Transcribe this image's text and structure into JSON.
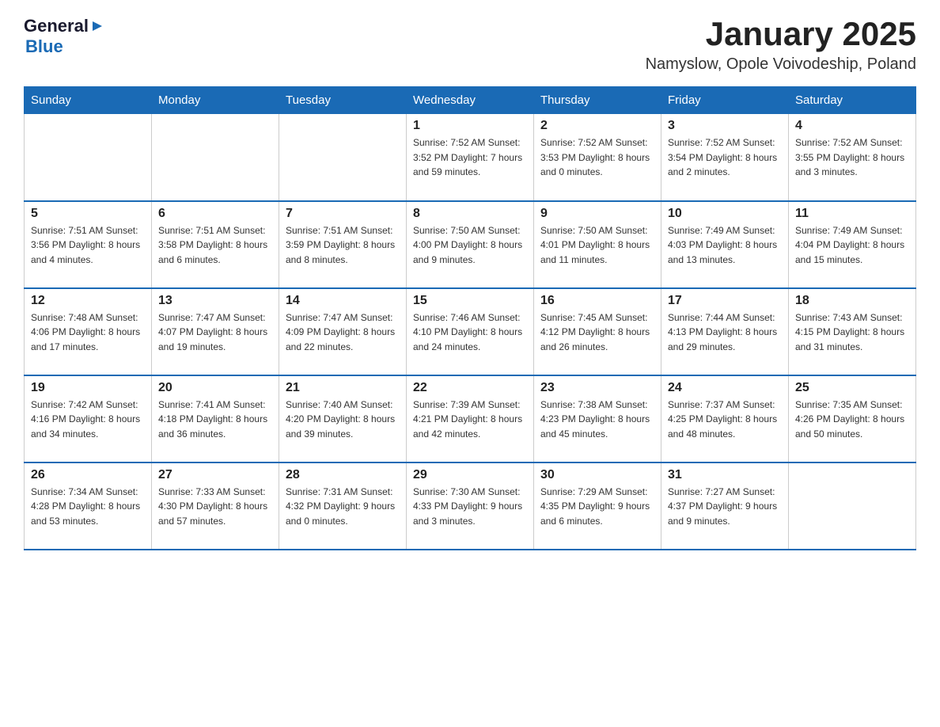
{
  "header": {
    "logo_general": "General",
    "logo_blue": "Blue",
    "month_title": "January 2025",
    "location": "Namyslow, Opole Voivodeship, Poland"
  },
  "weekdays": [
    "Sunday",
    "Monday",
    "Tuesday",
    "Wednesday",
    "Thursday",
    "Friday",
    "Saturday"
  ],
  "weeks": [
    [
      {
        "day": "",
        "info": ""
      },
      {
        "day": "",
        "info": ""
      },
      {
        "day": "",
        "info": ""
      },
      {
        "day": "1",
        "info": "Sunrise: 7:52 AM\nSunset: 3:52 PM\nDaylight: 7 hours\nand 59 minutes."
      },
      {
        "day": "2",
        "info": "Sunrise: 7:52 AM\nSunset: 3:53 PM\nDaylight: 8 hours\nand 0 minutes."
      },
      {
        "day": "3",
        "info": "Sunrise: 7:52 AM\nSunset: 3:54 PM\nDaylight: 8 hours\nand 2 minutes."
      },
      {
        "day": "4",
        "info": "Sunrise: 7:52 AM\nSunset: 3:55 PM\nDaylight: 8 hours\nand 3 minutes."
      }
    ],
    [
      {
        "day": "5",
        "info": "Sunrise: 7:51 AM\nSunset: 3:56 PM\nDaylight: 8 hours\nand 4 minutes."
      },
      {
        "day": "6",
        "info": "Sunrise: 7:51 AM\nSunset: 3:58 PM\nDaylight: 8 hours\nand 6 minutes."
      },
      {
        "day": "7",
        "info": "Sunrise: 7:51 AM\nSunset: 3:59 PM\nDaylight: 8 hours\nand 8 minutes."
      },
      {
        "day": "8",
        "info": "Sunrise: 7:50 AM\nSunset: 4:00 PM\nDaylight: 8 hours\nand 9 minutes."
      },
      {
        "day": "9",
        "info": "Sunrise: 7:50 AM\nSunset: 4:01 PM\nDaylight: 8 hours\nand 11 minutes."
      },
      {
        "day": "10",
        "info": "Sunrise: 7:49 AM\nSunset: 4:03 PM\nDaylight: 8 hours\nand 13 minutes."
      },
      {
        "day": "11",
        "info": "Sunrise: 7:49 AM\nSunset: 4:04 PM\nDaylight: 8 hours\nand 15 minutes."
      }
    ],
    [
      {
        "day": "12",
        "info": "Sunrise: 7:48 AM\nSunset: 4:06 PM\nDaylight: 8 hours\nand 17 minutes."
      },
      {
        "day": "13",
        "info": "Sunrise: 7:47 AM\nSunset: 4:07 PM\nDaylight: 8 hours\nand 19 minutes."
      },
      {
        "day": "14",
        "info": "Sunrise: 7:47 AM\nSunset: 4:09 PM\nDaylight: 8 hours\nand 22 minutes."
      },
      {
        "day": "15",
        "info": "Sunrise: 7:46 AM\nSunset: 4:10 PM\nDaylight: 8 hours\nand 24 minutes."
      },
      {
        "day": "16",
        "info": "Sunrise: 7:45 AM\nSunset: 4:12 PM\nDaylight: 8 hours\nand 26 minutes."
      },
      {
        "day": "17",
        "info": "Sunrise: 7:44 AM\nSunset: 4:13 PM\nDaylight: 8 hours\nand 29 minutes."
      },
      {
        "day": "18",
        "info": "Sunrise: 7:43 AM\nSunset: 4:15 PM\nDaylight: 8 hours\nand 31 minutes."
      }
    ],
    [
      {
        "day": "19",
        "info": "Sunrise: 7:42 AM\nSunset: 4:16 PM\nDaylight: 8 hours\nand 34 minutes."
      },
      {
        "day": "20",
        "info": "Sunrise: 7:41 AM\nSunset: 4:18 PM\nDaylight: 8 hours\nand 36 minutes."
      },
      {
        "day": "21",
        "info": "Sunrise: 7:40 AM\nSunset: 4:20 PM\nDaylight: 8 hours\nand 39 minutes."
      },
      {
        "day": "22",
        "info": "Sunrise: 7:39 AM\nSunset: 4:21 PM\nDaylight: 8 hours\nand 42 minutes."
      },
      {
        "day": "23",
        "info": "Sunrise: 7:38 AM\nSunset: 4:23 PM\nDaylight: 8 hours\nand 45 minutes."
      },
      {
        "day": "24",
        "info": "Sunrise: 7:37 AM\nSunset: 4:25 PM\nDaylight: 8 hours\nand 48 minutes."
      },
      {
        "day": "25",
        "info": "Sunrise: 7:35 AM\nSunset: 4:26 PM\nDaylight: 8 hours\nand 50 minutes."
      }
    ],
    [
      {
        "day": "26",
        "info": "Sunrise: 7:34 AM\nSunset: 4:28 PM\nDaylight: 8 hours\nand 53 minutes."
      },
      {
        "day": "27",
        "info": "Sunrise: 7:33 AM\nSunset: 4:30 PM\nDaylight: 8 hours\nand 57 minutes."
      },
      {
        "day": "28",
        "info": "Sunrise: 7:31 AM\nSunset: 4:32 PM\nDaylight: 9 hours\nand 0 minutes."
      },
      {
        "day": "29",
        "info": "Sunrise: 7:30 AM\nSunset: 4:33 PM\nDaylight: 9 hours\nand 3 minutes."
      },
      {
        "day": "30",
        "info": "Sunrise: 7:29 AM\nSunset: 4:35 PM\nDaylight: 9 hours\nand 6 minutes."
      },
      {
        "day": "31",
        "info": "Sunrise: 7:27 AM\nSunset: 4:37 PM\nDaylight: 9 hours\nand 9 minutes."
      },
      {
        "day": "",
        "info": ""
      }
    ]
  ]
}
